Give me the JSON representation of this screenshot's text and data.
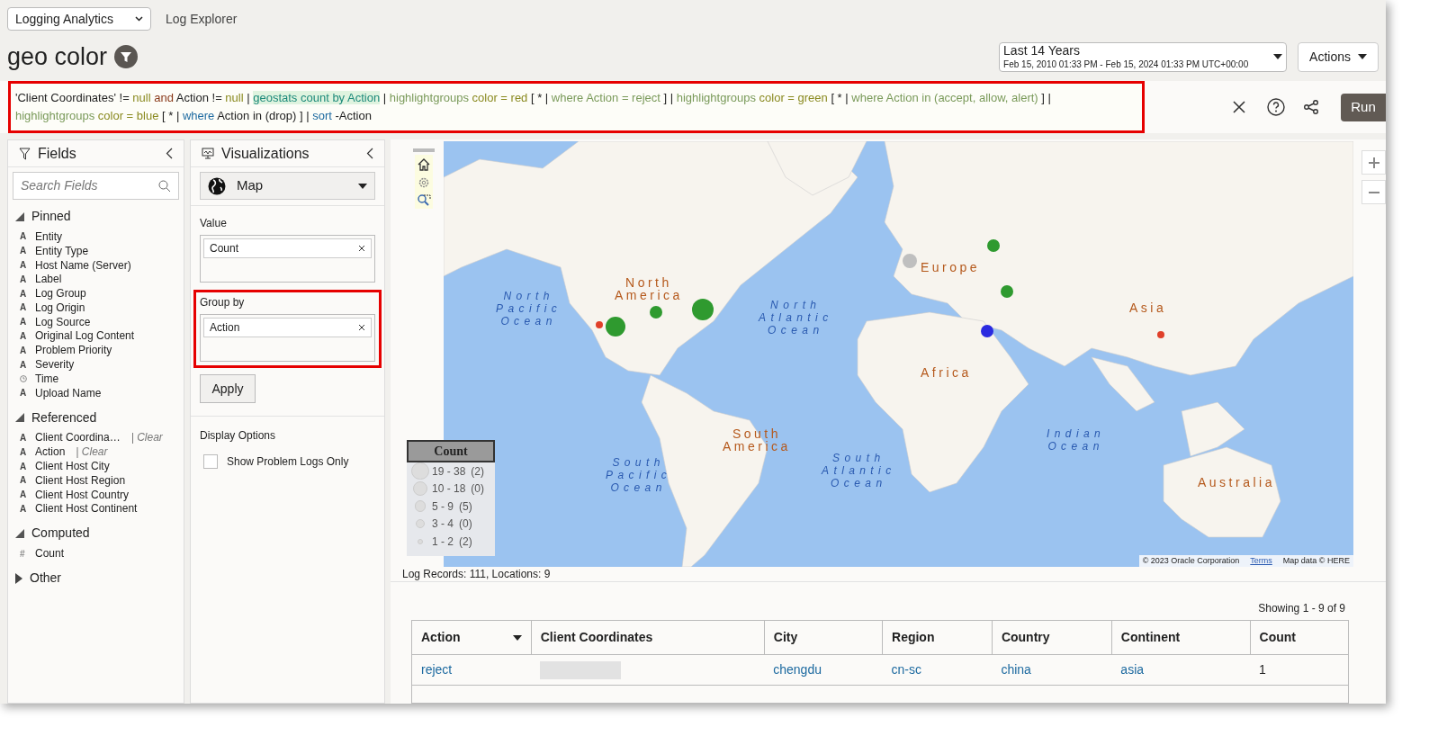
{
  "header": {
    "app_selector": "Logging Analytics",
    "breadcrumb": "Log Explorer",
    "title": "geo color",
    "time_range": {
      "label": "Last 14 Years",
      "range": "Feb 15, 2010 01:33 PM - Feb 15, 2024 01:33 PM UTC+00:00"
    },
    "actions": "Actions"
  },
  "query": {
    "lines": [
      [
        {
          "kind": "text",
          "text": "'Client Coordinates' != "
        },
        {
          "kind": "value",
          "text": "null"
        },
        {
          "kind": "operator",
          "text": " and "
        },
        {
          "kind": "text",
          "text": "Action != "
        },
        {
          "kind": "value",
          "text": "null"
        },
        {
          "kind": "text",
          "text": " | "
        },
        {
          "kind": "command",
          "text": "geostats count by Action"
        },
        {
          "kind": "text",
          "text": " | "
        },
        {
          "kind": "clause",
          "text": "highlightgroups"
        },
        {
          "kind": "value",
          "text": " color = red"
        },
        {
          "kind": "text",
          "text": " [ * | "
        },
        {
          "kind": "clause",
          "text": "where Action = reject"
        },
        {
          "kind": "text",
          "text": " ] | "
        },
        {
          "kind": "clause",
          "text": "highlightgroups"
        },
        {
          "kind": "value",
          "text": " color = green"
        },
        {
          "kind": "text",
          "text": " [ * | "
        },
        {
          "kind": "clause",
          "text": "where Action in (accept, allow, alert)"
        },
        {
          "kind": "text",
          "text": " ] |"
        }
      ],
      [
        {
          "kind": "clause",
          "text": "highlightgroups"
        },
        {
          "kind": "value",
          "text": " color = blue"
        },
        {
          "kind": "text",
          "text": " [ * | "
        },
        {
          "kind": "keyword",
          "text": "where"
        },
        {
          "kind": "text",
          "text": " Action in (drop) ] | "
        },
        {
          "kind": "keyword",
          "text": "sort"
        },
        {
          "kind": "text",
          "text": " -Action"
        }
      ]
    ],
    "run": "Run"
  },
  "fields": {
    "title": "Fields",
    "search": {
      "placeholder": "Search Fields"
    },
    "groups": [
      {
        "label": "Pinned",
        "expanded": true,
        "items": [
          {
            "kind": "string",
            "icon": "A",
            "label": "Entity"
          },
          {
            "kind": "string",
            "icon": "A",
            "label": "Entity Type"
          },
          {
            "kind": "string",
            "icon": "A",
            "label": "Host Name (Server)"
          },
          {
            "kind": "string",
            "icon": "A",
            "label": "Label"
          },
          {
            "kind": "string",
            "icon": "A",
            "label": "Log Group"
          },
          {
            "kind": "string",
            "icon": "A",
            "label": "Log Origin"
          },
          {
            "kind": "string",
            "icon": "A",
            "label": "Log Source"
          },
          {
            "kind": "string",
            "icon": "A",
            "label": "Original Log Content"
          },
          {
            "kind": "string",
            "icon": "A",
            "label": "Problem Priority"
          },
          {
            "kind": "string",
            "icon": "A",
            "label": "Severity"
          },
          {
            "kind": "time",
            "label": "Time"
          },
          {
            "kind": "string",
            "icon": "A",
            "label": "Upload Name"
          }
        ]
      },
      {
        "label": "Referenced",
        "expanded": true,
        "items": [
          {
            "kind": "string",
            "icon": "A",
            "label": "Client Coordina…",
            "clear": "| Clear"
          },
          {
            "kind": "string",
            "icon": "A",
            "label": "Action",
            "clear": "| Clear"
          },
          {
            "kind": "string",
            "icon": "A",
            "label": "Client Host City"
          },
          {
            "kind": "string",
            "icon": "A",
            "label": "Client Host Region"
          },
          {
            "kind": "string",
            "icon": "A",
            "label": "Client Host Country"
          },
          {
            "kind": "string",
            "icon": "A",
            "label": "Client Host Continent"
          }
        ]
      },
      {
        "label": "Computed",
        "expanded": true,
        "items": [
          {
            "kind": "number",
            "icon": "#",
            "label": "Count"
          }
        ]
      },
      {
        "label": "Other",
        "expanded": false
      }
    ]
  },
  "visualizations": {
    "title": "Visualizations",
    "type": "Map",
    "value": {
      "label": "Value",
      "chip": "Count"
    },
    "group_by": {
      "label": "Group by",
      "chip": "Action"
    },
    "apply": "Apply",
    "display_options": {
      "label": "Display Options",
      "options": [
        {
          "label": "Show Problem Logs Only",
          "checked": false
        }
      ]
    }
  },
  "map": {
    "labels": [
      {
        "kind": "continent",
        "text": "North America"
      },
      {
        "kind": "continent",
        "text": "South America"
      },
      {
        "kind": "continent",
        "text": "Europe"
      },
      {
        "kind": "continent",
        "text": "Africa"
      },
      {
        "kind": "continent",
        "text": "Asia"
      },
      {
        "kind": "continent",
        "text": "Australia"
      },
      {
        "kind": "ocean",
        "text": "North Pacific Ocean"
      },
      {
        "kind": "ocean",
        "text": "North Atlantic Ocean"
      },
      {
        "kind": "ocean",
        "text": "South Pacific Ocean"
      },
      {
        "kind": "ocean",
        "text": "South Atlantic Ocean"
      },
      {
        "kind": "ocean",
        "text": "Indian Ocean"
      }
    ],
    "markers": [
      {
        "color": "#e0402a"
      },
      {
        "color": "#2f9a2f"
      },
      {
        "color": "#2f9a2f"
      },
      {
        "color": "#2f9a2f"
      },
      {
        "color": "#bfbfbf"
      },
      {
        "color": "#2f9a2f"
      },
      {
        "color": "#2f9a2f"
      },
      {
        "color": "#2a2ae0"
      },
      {
        "color": "#e0402a"
      }
    ],
    "legend": {
      "title": "Count",
      "items": [
        {
          "range": "19 - 38",
          "count": "(2)"
        },
        {
          "range": "10 - 18",
          "count": "(0)"
        },
        {
          "range": "5 - 9",
          "count": "(5)"
        },
        {
          "range": "3 - 4",
          "count": "(0)"
        },
        {
          "range": "1 - 2",
          "count": "(2)"
        }
      ]
    },
    "attribution": "© 2023 Oracle Corporation",
    "terms": "Terms",
    "map_data": "Map data © HERE"
  },
  "summary": "Log Records: 111, Locations: 9",
  "table": {
    "showing": "Showing 1 - 9 of 9",
    "columns": [
      {
        "label": "Action",
        "sortable": true
      },
      {
        "label": "Client Coordinates",
        "sortable": false
      },
      {
        "label": "City",
        "sortable": false
      },
      {
        "label": "Region",
        "sortable": false
      },
      {
        "label": "Country",
        "sortable": false
      },
      {
        "label": "Continent",
        "sortable": false
      },
      {
        "label": "Count",
        "sortable": false
      }
    ],
    "rows": [
      [
        {
          "kind": "link",
          "text": "reject"
        },
        {
          "kind": "redacted"
        },
        {
          "kind": "link",
          "text": "chengdu"
        },
        {
          "kind": "link",
          "text": "cn-sc"
        },
        {
          "kind": "link",
          "text": "china"
        },
        {
          "kind": "link",
          "text": "asia"
        },
        {
          "kind": "number",
          "text": "1"
        }
      ]
    ]
  }
}
